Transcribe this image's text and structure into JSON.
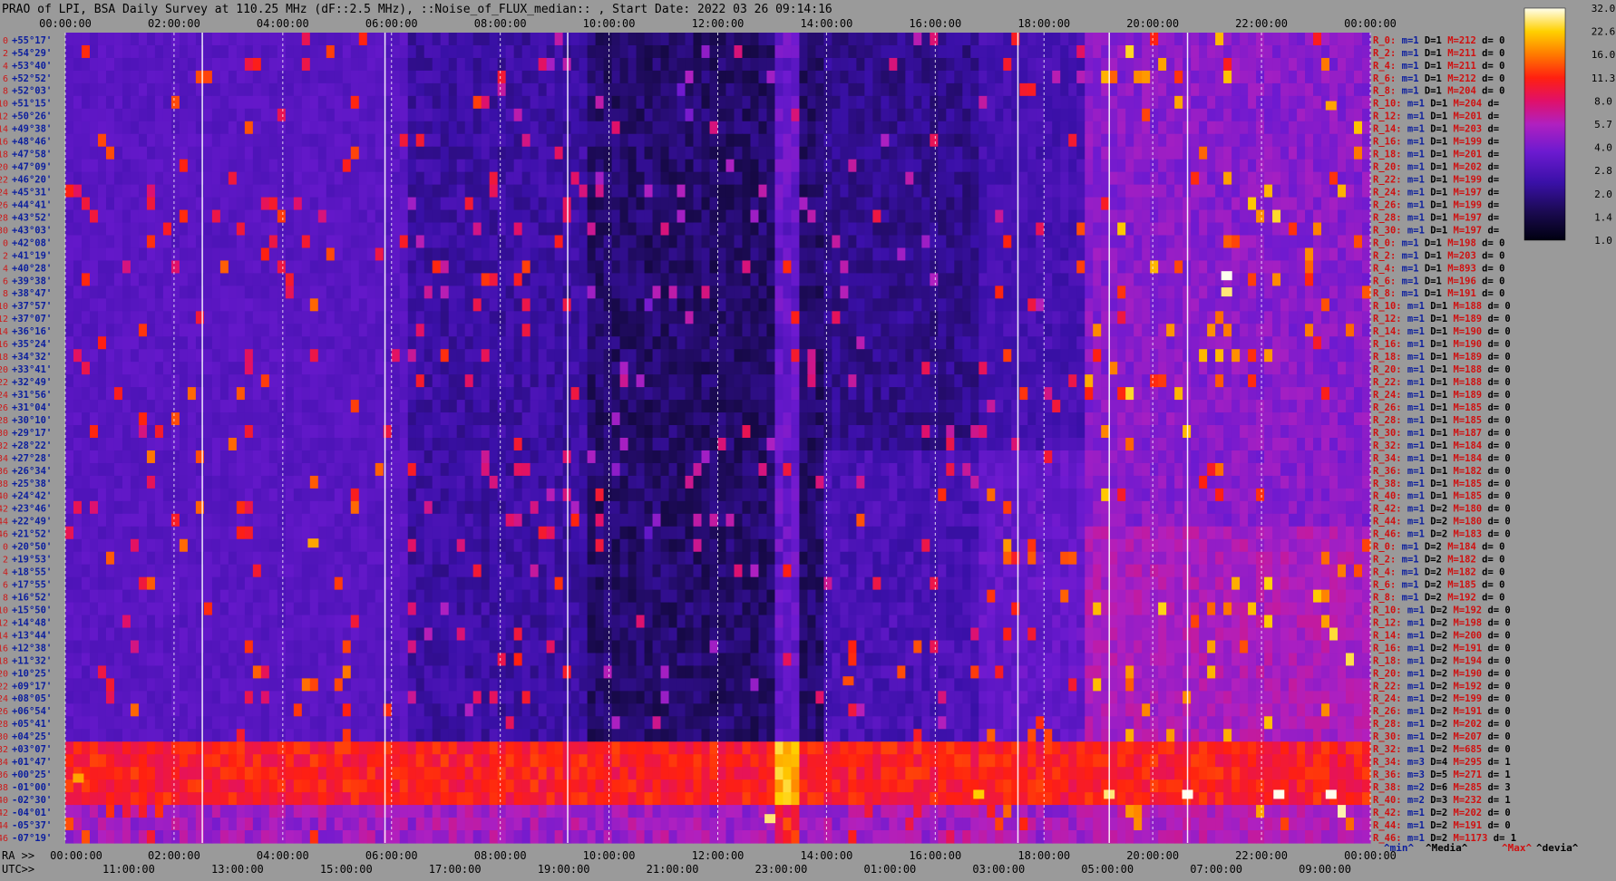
{
  "chart_data": {
    "type": "heatmap",
    "title": "PRAO of LPI, BSA Daily Survey at 110.25 MHz (dF::2.5 MHz), ::Noise_of_FLUX_median:: , Start Date: 2022 03 26 09:14:16",
    "x_top_ticks": [
      "00:00:00",
      "02:00:00",
      "04:00:00",
      "06:00:00",
      "08:00:00",
      "10:00:00",
      "12:00:00",
      "14:00:00",
      "16:00:00",
      "18:00:00",
      "20:00:00",
      "22:00:00",
      "00:00:00"
    ],
    "x_ra_prefix": "RA >>",
    "x_ra_ticks": [
      "00:00:00",
      "02:00:00",
      "04:00:00",
      "06:00:00",
      "08:00:00",
      "10:00:00",
      "12:00:00",
      "14:00:00",
      "16:00:00",
      "18:00:00",
      "20:00:00",
      "22:00:00",
      "00:00:00"
    ],
    "x_utc_prefix": "UTC>>",
    "x_utc_ticks": [
      "11:00:00",
      "13:00:00",
      "15:00:00",
      "17:00:00",
      "19:00:00",
      "21:00:00",
      "23:00:00",
      "01:00:00",
      "03:00:00",
      "05:00:00",
      "07:00:00",
      "09:00:00"
    ],
    "beam_declinations": [
      "+55°17'",
      "+54°29'",
      "+53°40'",
      "+52°52'",
      "+52°03'",
      "+51°15'",
      "+50°26'",
      "+49°38'",
      "+48°46'",
      "+47°58'",
      "+47°09'",
      "+46°20'",
      "+45°31'",
      "+44°41'",
      "+43°52'",
      "+43°03'",
      "+42°08'",
      "+41°19'",
      "+40°28'",
      "+39°38'",
      "+38°47'",
      "+37°57'",
      "+37°07'",
      "+36°16'",
      "+35°24'",
      "+34°32'",
      "+33°41'",
      "+32°49'",
      "+31°56'",
      "+31°04'",
      "+30°10'",
      "+29°17'",
      "+28°22'",
      "+27°28'",
      "+26°34'",
      "+25°38'",
      "+24°42'",
      "+23°46'",
      "+22°49'",
      "+21°52'",
      "+20°50'",
      "+19°53'",
      "+18°55'",
      "+17°55'",
      "+16°52'",
      "+15°50'",
      "+14°48'",
      "+13°44'",
      "+12°38'",
      "+11°32'",
      "+10°25'",
      "+09°17'",
      "+08°05'",
      "+06°54'",
      "+05°41'",
      "+04°25'",
      "+03°07'",
      "+01°47'",
      "+00°25'",
      "-01°00'",
      "-02°30'",
      "-04°01'",
      "-05°37'",
      "-07°19'"
    ],
    "beam_numbers": [
      "0",
      "2",
      "4",
      "6",
      "8",
      "10",
      "12",
      "14",
      "16",
      "18",
      "20",
      "22",
      "24",
      "26",
      "28",
      "30",
      "0",
      "2",
      "4",
      "6",
      "8",
      "10",
      "12",
      "14",
      "16",
      "18",
      "20",
      "22",
      "24",
      "26",
      "28",
      "30",
      "32",
      "34",
      "36",
      "38",
      "40",
      "42",
      "44",
      "46",
      "0",
      "2",
      "4",
      "6",
      "8",
      "10",
      "12",
      "14",
      "16",
      "18",
      "20",
      "22",
      "24",
      "26",
      "28",
      "30",
      "32",
      "34",
      "36",
      "38",
      "40",
      "42",
      "44",
      "46"
    ],
    "beam_stats": [
      {
        "r": "R_0:",
        "m": "m=1",
        "D": "D=1",
        "M": "M=212",
        "d": "d= 0"
      },
      {
        "r": "R_2:",
        "m": "m=1",
        "D": "D=1",
        "M": "M=211",
        "d": "d= 0"
      },
      {
        "r": "R_4:",
        "m": "m=1",
        "D": "D=1",
        "M": "M=211",
        "d": "d= 0"
      },
      {
        "r": "R_6:",
        "m": "m=1",
        "D": "D=1",
        "M": "M=212",
        "d": "d= 0"
      },
      {
        "r": "R_8:",
        "m": "m=1",
        "D": "D=1",
        "M": "M=204",
        "d": "d= 0"
      },
      {
        "r": "R_10:",
        "m": "m=1",
        "D": "D=1",
        "M": "M=204",
        "d": "d="
      },
      {
        "r": "R_12:",
        "m": "m=1",
        "D": "D=1",
        "M": "M=201",
        "d": "d="
      },
      {
        "r": "R_14:",
        "m": "m=1",
        "D": "D=1",
        "M": "M=203",
        "d": "d="
      },
      {
        "r": "R_16:",
        "m": "m=1",
        "D": "D=1",
        "M": "M=199",
        "d": "d="
      },
      {
        "r": "R_18:",
        "m": "m=1",
        "D": "D=1",
        "M": "M=201",
        "d": "d="
      },
      {
        "r": "R_20:",
        "m": "m=1",
        "D": "D=1",
        "M": "M=202",
        "d": "d="
      },
      {
        "r": "R_22:",
        "m": "m=1",
        "D": "D=1",
        "M": "M=199",
        "d": "d="
      },
      {
        "r": "R_24:",
        "m": "m=1",
        "D": "D=1",
        "M": "M=197",
        "d": "d="
      },
      {
        "r": "R_26:",
        "m": "m=1",
        "D": "D=1",
        "M": "M=199",
        "d": "d="
      },
      {
        "r": "R_28:",
        "m": "m=1",
        "D": "D=1",
        "M": "M=197",
        "d": "d="
      },
      {
        "r": "R_30:",
        "m": "m=1",
        "D": "D=1",
        "M": "M=197",
        "d": "d="
      },
      {
        "r": "R_0:",
        "m": "m=1",
        "D": "D=1",
        "M": "M=198",
        "d": "d= 0"
      },
      {
        "r": "R_2:",
        "m": "m=1",
        "D": "D=1",
        "M": "M=203",
        "d": "d= 0"
      },
      {
        "r": "R_4:",
        "m": "m=1",
        "D": "D=1",
        "M": "M=893",
        "d": "d= 0"
      },
      {
        "r": "R_6:",
        "m": "m=1",
        "D": "D=1",
        "M": "M=196",
        "d": "d= 0"
      },
      {
        "r": "R_8:",
        "m": "m=1",
        "D": "D=1",
        "M": "M=191",
        "d": "d= 0"
      },
      {
        "r": "R_10:",
        "m": "m=1",
        "D": "D=1",
        "M": "M=188",
        "d": "d= 0"
      },
      {
        "r": "R_12:",
        "m": "m=1",
        "D": "D=1",
        "M": "M=189",
        "d": "d= 0"
      },
      {
        "r": "R_14:",
        "m": "m=1",
        "D": "D=1",
        "M": "M=190",
        "d": "d= 0"
      },
      {
        "r": "R_16:",
        "m": "m=1",
        "D": "D=1",
        "M": "M=190",
        "d": "d= 0"
      },
      {
        "r": "R_18:",
        "m": "m=1",
        "D": "D=1",
        "M": "M=189",
        "d": "d= 0"
      },
      {
        "r": "R_20:",
        "m": "m=1",
        "D": "D=1",
        "M": "M=188",
        "d": "d= 0"
      },
      {
        "r": "R_22:",
        "m": "m=1",
        "D": "D=1",
        "M": "M=188",
        "d": "d= 0"
      },
      {
        "r": "R_24:",
        "m": "m=1",
        "D": "D=1",
        "M": "M=189",
        "d": "d= 0"
      },
      {
        "r": "R_26:",
        "m": "m=1",
        "D": "D=1",
        "M": "M=185",
        "d": "d= 0"
      },
      {
        "r": "R_28:",
        "m": "m=1",
        "D": "D=1",
        "M": "M=185",
        "d": "d= 0"
      },
      {
        "r": "R_30:",
        "m": "m=1",
        "D": "D=1",
        "M": "M=187",
        "d": "d= 0"
      },
      {
        "r": "R_32:",
        "m": "m=1",
        "D": "D=1",
        "M": "M=184",
        "d": "d= 0"
      },
      {
        "r": "R_34:",
        "m": "m=1",
        "D": "D=1",
        "M": "M=184",
        "d": "d= 0"
      },
      {
        "r": "R_36:",
        "m": "m=1",
        "D": "D=1",
        "M": "M=182",
        "d": "d= 0"
      },
      {
        "r": "R_38:",
        "m": "m=1",
        "D": "D=1",
        "M": "M=185",
        "d": "d= 0"
      },
      {
        "r": "R_40:",
        "m": "m=1",
        "D": "D=1",
        "M": "M=185",
        "d": "d= 0"
      },
      {
        "r": "R_42:",
        "m": "m=1",
        "D": "D=2",
        "M": "M=180",
        "d": "d= 0"
      },
      {
        "r": "R_44:",
        "m": "m=1",
        "D": "D=2",
        "M": "M=180",
        "d": "d= 0"
      },
      {
        "r": "R_46:",
        "m": "m=1",
        "D": "D=2",
        "M": "M=183",
        "d": "d= 0"
      },
      {
        "r": "R_0:",
        "m": "m=1",
        "D": "D=2",
        "M": "M=184",
        "d": "d= 0"
      },
      {
        "r": "R_2:",
        "m": "m=1",
        "D": "D=2",
        "M": "M=182",
        "d": "d= 0"
      },
      {
        "r": "R_4:",
        "m": "m=1",
        "D": "D=2",
        "M": "M=182",
        "d": "d= 0"
      },
      {
        "r": "R_6:",
        "m": "m=1",
        "D": "D=2",
        "M": "M=185",
        "d": "d= 0"
      },
      {
        "r": "R_8:",
        "m": "m=1",
        "D": "D=2",
        "M": "M=192",
        "d": "d= 0"
      },
      {
        "r": "R_10:",
        "m": "m=1",
        "D": "D=2",
        "M": "M=192",
        "d": "d= 0"
      },
      {
        "r": "R_12:",
        "m": "m=1",
        "D": "D=2",
        "M": "M=198",
        "d": "d= 0"
      },
      {
        "r": "R_14:",
        "m": "m=1",
        "D": "D=2",
        "M": "M=200",
        "d": "d= 0"
      },
      {
        "r": "R_16:",
        "m": "m=1",
        "D": "D=2",
        "M": "M=191",
        "d": "d= 0"
      },
      {
        "r": "R_18:",
        "m": "m=1",
        "D": "D=2",
        "M": "M=194",
        "d": "d= 0"
      },
      {
        "r": "R_20:",
        "m": "m=1",
        "D": "D=2",
        "M": "M=190",
        "d": "d= 0"
      },
      {
        "r": "R_22:",
        "m": "m=1",
        "D": "D=2",
        "M": "M=192",
        "d": "d= 0"
      },
      {
        "r": "R_24:",
        "m": "m=1",
        "D": "D=2",
        "M": "M=199",
        "d": "d= 0"
      },
      {
        "r": "R_26:",
        "m": "m=1",
        "D": "D=2",
        "M": "M=191",
        "d": "d= 0"
      },
      {
        "r": "R_28:",
        "m": "m=1",
        "D": "D=2",
        "M": "M=202",
        "d": "d= 0"
      },
      {
        "r": "R_30:",
        "m": "m=1",
        "D": "D=2",
        "M": "M=207",
        "d": "d= 0"
      },
      {
        "r": "R_32:",
        "m": "m=1",
        "D": "D=2",
        "M": "M=685",
        "d": "d= 0"
      },
      {
        "r": "R_34:",
        "m": "m=3",
        "D": "D=4",
        "M": "M=295",
        "d": "d= 1"
      },
      {
        "r": "R_36:",
        "m": "m=3",
        "D": "D=5",
        "M": "M=271",
        "d": "d= 1"
      },
      {
        "r": "R_38:",
        "m": "m=2",
        "D": "D=6",
        "M": "M=285",
        "d": "d= 3"
      },
      {
        "r": "R_40:",
        "m": "m=2",
        "D": "D=3",
        "M": "M=232",
        "d": "d= 1"
      },
      {
        "r": "R_42:",
        "m": "m=1",
        "D": "D=2",
        "M": "M=202",
        "d": "d= 0"
      },
      {
        "r": "R_44:",
        "m": "m=1",
        "D": "D=2",
        "M": "M=191",
        "d": "d= 0"
      },
      {
        "r": "R_46:",
        "m": "m=1",
        "D": "D=2",
        "M": "M=1173",
        "d": "d= 1"
      }
    ],
    "stats_legend": {
      "min": "^min^",
      "median": "^Media^",
      "max": "^Max^",
      "devia": "^devia^"
    },
    "colorbar_ticks": [
      "32.0",
      "22.6",
      "16.0",
      "11.3",
      "8.0",
      "5.7",
      "4.0",
      "2.8",
      "2.0",
      "1.4",
      "1.0"
    ],
    "colorbar_range": [
      1.0,
      32.0
    ],
    "colorbar_scale": "log",
    "colors": {
      "background": "#9a9a9a",
      "label_blue": "#0b1e9e",
      "label_red": "#d01010",
      "label_black": "#000000",
      "beam_number": "#cc1a1a"
    }
  }
}
